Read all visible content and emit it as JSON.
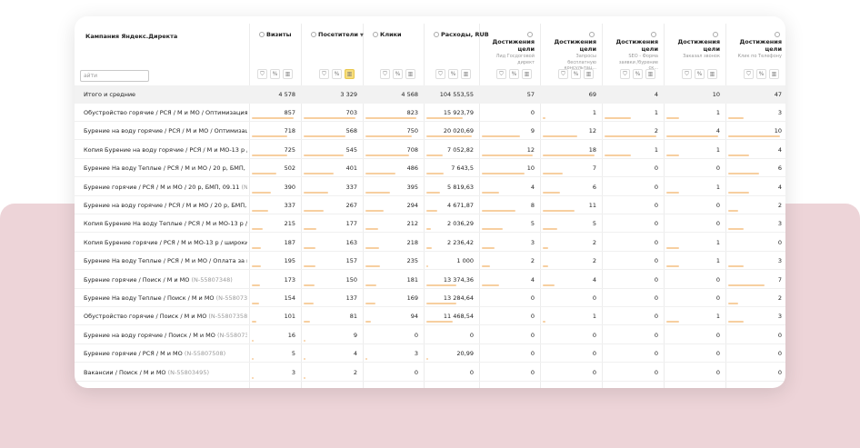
{
  "table": {
    "campaign_header": "Кампания Яндекс.Директа",
    "search_placeholder": "айти",
    "columns": [
      {
        "label": "Визиты",
        "sort": ""
      },
      {
        "label": "Посетители",
        "sort": "▼"
      },
      {
        "label": "Клики",
        "sort": ""
      },
      {
        "label": "Расходы, RUB",
        "sort": ""
      }
    ],
    "goal_columns": [
      {
        "label": "Достижения цели",
        "sub": "Лид Госдоговой директ"
      },
      {
        "label": "Достижения цели",
        "sub": "Запросы бесплатную консультац..."
      },
      {
        "label": "Достижения цели",
        "sub": "SEO - Форма заявки /бурение ск..."
      },
      {
        "label": "Достижения цели",
        "sub": "Заказал звонок"
      },
      {
        "label": "Достижения цели",
        "sub": "Клик по Телефону"
      }
    ],
    "total": {
      "label": "Итого и средние",
      "values": [
        "4 578",
        "3 329",
        "4 568",
        "104 553,55",
        "57",
        "69",
        "4",
        "10",
        "47"
      ]
    },
    "rows": [
      {
        "name": "Обустройство горячие / РСЯ / М и МО / Оптимизация ...",
        "id": "",
        "values": [
          "857",
          "703",
          "823",
          "15 923,79",
          "0",
          "1",
          "1",
          "1",
          "3"
        ]
      },
      {
        "name": "Бурение на воду горячие / РСЯ / М и МО / Оптимизац...",
        "id": "",
        "values": [
          "718",
          "568",
          "750",
          "20 020,69",
          "9",
          "12",
          "2",
          "4",
          "10"
        ]
      },
      {
        "name": "Копия Бурение на воду горячие / РСЯ / М и МО-13 р /...",
        "id": "",
        "values": [
          "725",
          "545",
          "708",
          "7 052,82",
          "12",
          "18",
          "1",
          "1",
          "4"
        ]
      },
      {
        "name": "Бурение На воду Теплые / РСЯ / М и МО / 20 р, БМП, ...",
        "id": "",
        "values": [
          "502",
          "401",
          "486",
          "7 643,5",
          "10",
          "7",
          "0",
          "0",
          "6"
        ]
      },
      {
        "name": "Бурение горячие / РСЯ / М и МО / 20 р, БМП, 09.11 ",
        "id": "(N...",
        "values": [
          "390",
          "337",
          "395",
          "5 819,63",
          "4",
          "6",
          "0",
          "1",
          "4"
        ]
      },
      {
        "name": "Бурение на воду горячие / РСЯ / М и МО / 20 р, БМП, ...",
        "id": "",
        "values": [
          "337",
          "267",
          "294",
          "4 671,87",
          "8",
          "11",
          "0",
          "0",
          "2"
        ]
      },
      {
        "name": "Копия Бурение На воду Теплые / РСЯ / М и МО-13 р /...",
        "id": "",
        "values": [
          "215",
          "177",
          "212",
          "2 036,29",
          "5",
          "5",
          "0",
          "0",
          "3"
        ]
      },
      {
        "name": "Копия Бурение горячие / РСЯ / М и МО-13 р / широки...",
        "id": "",
        "values": [
          "187",
          "163",
          "218",
          "2 236,42",
          "3",
          "2",
          "0",
          "1",
          "0"
        ]
      },
      {
        "name": "Бурение На воду Теплые / РСЯ / М и МО / Оплата за к...",
        "id": "",
        "values": [
          "195",
          "157",
          "235",
          "1 000",
          "2",
          "2",
          "0",
          "1",
          "3"
        ]
      },
      {
        "name": "Бурение горячие / Поиск / М и МО ",
        "id": "(N-55807348)",
        "values": [
          "173",
          "150",
          "181",
          "13 374,36",
          "4",
          "4",
          "0",
          "0",
          "7"
        ]
      },
      {
        "name": "Бурение На воду Теплые / Поиск / М и МО ",
        "id": "(N-55807365)",
        "values": [
          "154",
          "137",
          "169",
          "13 284,64",
          "0",
          "0",
          "0",
          "0",
          "2"
        ]
      },
      {
        "name": "Обустройство горячие / Поиск / М и МО ",
        "id": "(N-55807358)",
        "values": [
          "101",
          "81",
          "94",
          "11 468,54",
          "0",
          "1",
          "0",
          "1",
          "3"
        ]
      },
      {
        "name": "Бурение на воду горячие / Поиск / М и МО ",
        "id": "(N-55807373...",
        "values": [
          "16",
          "9",
          "0",
          "0",
          "0",
          "0",
          "0",
          "0",
          "0"
        ]
      },
      {
        "name": "Бурение горячие / РСЯ / М и МО ",
        "id": "(N-55807508)",
        "values": [
          "5",
          "4",
          "3",
          "20,99",
          "0",
          "0",
          "0",
          "0",
          "0"
        ]
      },
      {
        "name": "Вакансии / Поиск / М и МО ",
        "id": "(N-55803495)",
        "values": [
          "3",
          "2",
          "0",
          "0",
          "0",
          "0",
          "0",
          "0",
          "0"
        ]
      }
    ]
  },
  "colors": {
    "bar": "#f7cfa0",
    "active_tool": "#f6dd7e",
    "background_band": "#edd4d8"
  },
  "tool_icons": [
    "filter-icon",
    "percent-icon",
    "chart-icon"
  ],
  "tool_glyphs": [
    "⛉",
    "%",
    "▥"
  ]
}
